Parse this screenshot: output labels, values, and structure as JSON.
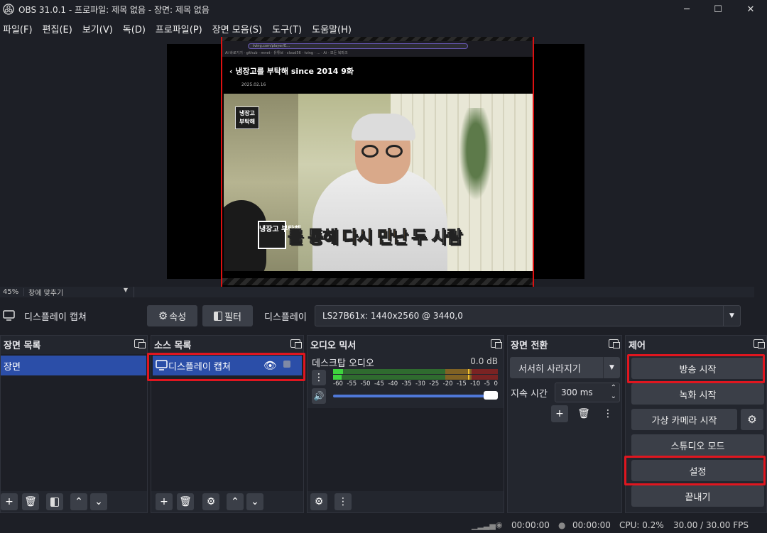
{
  "window": {
    "title": "OBS 31.0.1 - 프로파일: 제목 없음 - 장면: 제목 없음",
    "minimize": "─",
    "maximize": "☐",
    "close": "✕"
  },
  "menu": [
    "파일(F)",
    "편집(E)",
    "보기(V)",
    "독(D)",
    "프로파일(P)",
    "장면 모음(S)",
    "도구(T)",
    "도움말(H)"
  ],
  "preview": {
    "browser_url": "tving.com/player/E...",
    "bookmarks": "Ai 바로가기 · github · mnet · 유튜브 · cloud56 · tving · ... · Ai · 모든 북마크",
    "page_title": "냉장고를 부탁해 since 2014 9화",
    "page_date": "2025.02.16",
    "sticker": "냉장고 부탁해",
    "caption_logo": "냉장고 부탁해",
    "caption_1": "를 통해",
    "caption_2": "다시 만난",
    "caption_3": "두 사람"
  },
  "zoom": {
    "percent": "45%",
    "fit_label": "창에 맞추기"
  },
  "source_toolbar": {
    "source_name": "디스플레이 캡쳐",
    "properties_label": "속성",
    "filters_label": "필터",
    "display_label": "디스플레이",
    "display_value": "LS27B61x: 1440x2560 @ 3440,0"
  },
  "scenes": {
    "title": "장면 목록",
    "items": [
      "장면"
    ]
  },
  "sources": {
    "title": "소스 목록",
    "items": [
      "디스플레이 캡쳐"
    ]
  },
  "mixer": {
    "title": "오디오 믹서",
    "channel": "데스크탑 오디오",
    "db": "0.0 dB",
    "ticks": [
      "-60",
      "-55",
      "-50",
      "-45",
      "-40",
      "-35",
      "-30",
      "-25",
      "-20",
      "-15",
      "-10",
      "-5",
      "0"
    ],
    "volume_level": 1.0
  },
  "transitions": {
    "title": "장면 전환",
    "type": "서서히 사라지기",
    "duration_label": "지속 시간",
    "duration_value": "300 ms"
  },
  "controls": {
    "title": "제어",
    "start_streaming": "방송 시작",
    "start_recording": "녹화 시작",
    "virtual_camera": "가상 카메라 시작",
    "studio_mode": "스튜디오 모드",
    "settings": "설정",
    "exit": "끝내기"
  },
  "status": {
    "stream_time": "00:00:00",
    "record_time": "00:00:00",
    "cpu": "CPU: 0.2%",
    "fps": "30.00 / 30.00 FPS"
  },
  "colors": {
    "accent": "#2b4ea8",
    "highlight_box": "#e0161f",
    "background": "#1d1f26"
  }
}
